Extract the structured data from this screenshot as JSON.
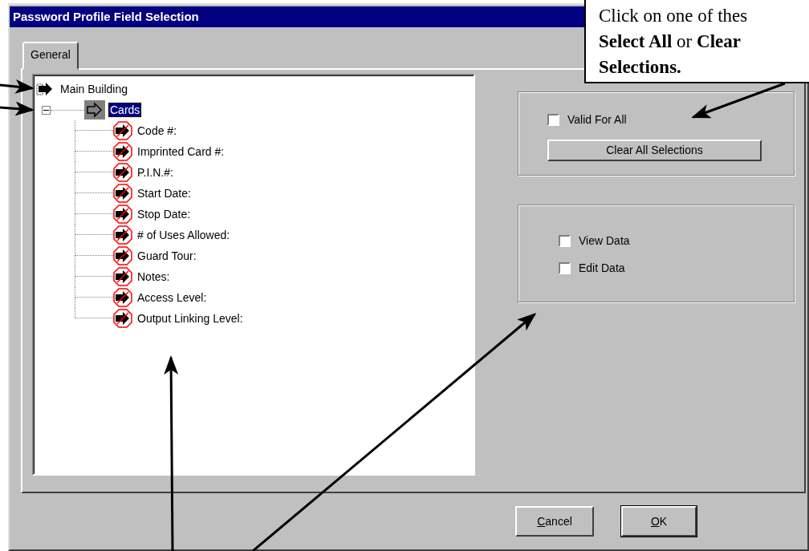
{
  "window": {
    "title": "Password Profile Field Selection"
  },
  "tabs": [
    {
      "label": "General",
      "selected": true
    }
  ],
  "tree": [
    {
      "label": "Main Building",
      "kind": "building",
      "selected": false,
      "children": [
        {
          "label": "Cards",
          "kind": "group",
          "selected": true,
          "expanded": true,
          "children": [
            {
              "label": "Code #:",
              "kind": "field",
              "selected": false,
              "denied": true
            },
            {
              "label": "Imprinted Card #:",
              "kind": "field",
              "selected": false,
              "denied": true
            },
            {
              "label": "P.I.N.#:",
              "kind": "field",
              "selected": false,
              "denied": true
            },
            {
              "label": "Start Date:",
              "kind": "field",
              "selected": false,
              "denied": true
            },
            {
              "label": "Stop Date:",
              "kind": "field",
              "selected": false,
              "denied": true
            },
            {
              "label": "# of Uses Allowed:",
              "kind": "field",
              "selected": false,
              "denied": true
            },
            {
              "label": "Guard Tour:",
              "kind": "field",
              "selected": false,
              "denied": true
            },
            {
              "label": "Notes:",
              "kind": "field",
              "selected": false,
              "denied": true
            },
            {
              "label": "Access Level:",
              "kind": "field",
              "selected": false,
              "denied": true
            },
            {
              "label": "Output Linking Level:",
              "kind": "field",
              "selected": false,
              "denied": true
            }
          ]
        }
      ]
    }
  ],
  "selection_group": {
    "checkbox": {
      "label": "Valid For All",
      "checked": false
    },
    "button": "Clear All Selections"
  },
  "permissions": [
    {
      "label": "View Data",
      "checked": false
    },
    {
      "label": "Edit Data",
      "checked": false
    }
  ],
  "buttons": [
    {
      "label": "Cancel",
      "default": false
    },
    {
      "label": "OK",
      "default": true
    }
  ],
  "callout": {
    "lines": [
      "Click on one of thes",
      "**Select All** or **Clear**",
      "**Selections.**"
    ]
  }
}
